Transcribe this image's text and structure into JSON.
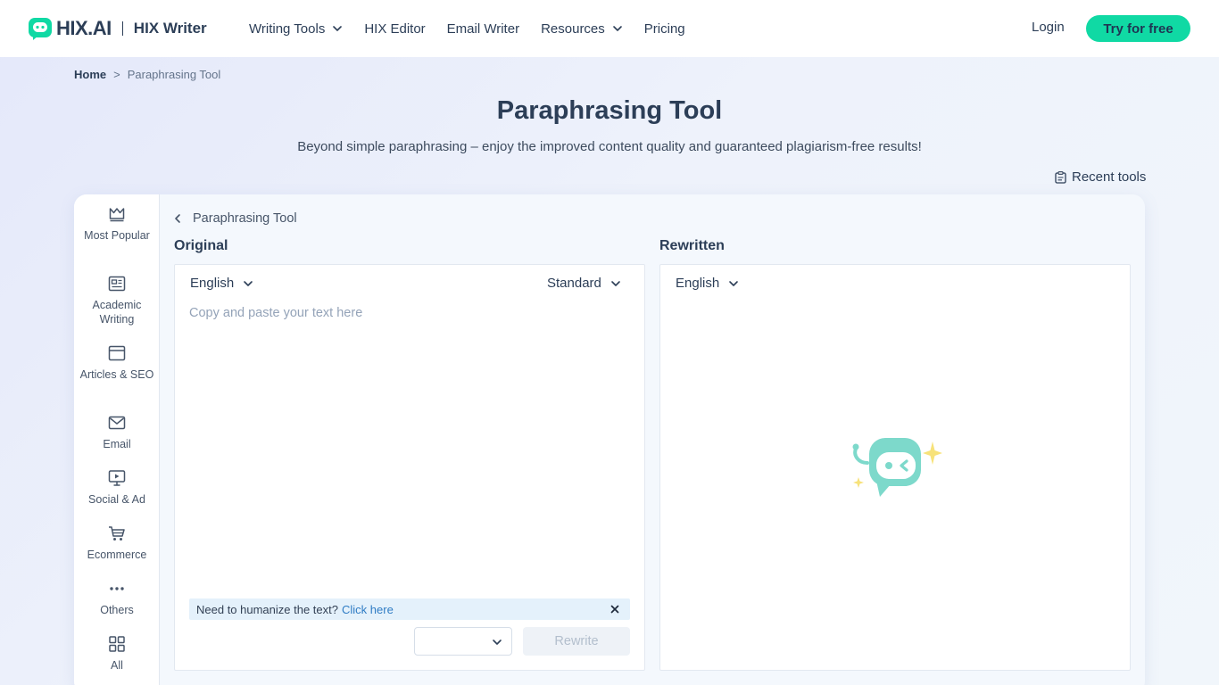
{
  "header": {
    "logo_text": "HIX.AI",
    "product": "HIX Writer",
    "nav": [
      {
        "label": "Writing Tools",
        "dropdown": true
      },
      {
        "label": "HIX Editor",
        "dropdown": false
      },
      {
        "label": "Email Writer",
        "dropdown": false
      },
      {
        "label": "Resources",
        "dropdown": true
      },
      {
        "label": "Pricing",
        "dropdown": false
      }
    ],
    "login": "Login",
    "cta": "Try for free"
  },
  "breadcrumb": {
    "home": "Home",
    "separator": ">",
    "current": "Paraphrasing Tool"
  },
  "page": {
    "title": "Paraphrasing Tool",
    "subtitle": "Beyond simple paraphrasing – enjoy the improved content quality and guaranteed plagiarism-free results!",
    "recent_tools": "Recent tools"
  },
  "sidebar": {
    "items": [
      {
        "icon": "crown-icon",
        "label": "Most Popular"
      },
      {
        "icon": "newspaper-icon",
        "label": "Academic Writing"
      },
      {
        "icon": "browser-window-icon",
        "label": "Articles & SEO"
      },
      {
        "icon": "mail-icon",
        "label": "Email"
      },
      {
        "icon": "presentation-icon",
        "label": "Social & Ad"
      },
      {
        "icon": "cart-icon",
        "label": "Ecommerce"
      },
      {
        "icon": "more-dots-icon",
        "label": "Others"
      },
      {
        "icon": "grid-icon",
        "label": "All"
      }
    ]
  },
  "tool": {
    "back_label": "Paraphrasing Tool",
    "original": {
      "heading": "Original",
      "language": "English",
      "mode": "Standard",
      "placeholder": "Copy and paste your text here",
      "value": "",
      "hint_text": "Need to humanize the text?",
      "hint_link": "Click here",
      "rewrite_label": "Rewrite"
    },
    "rewritten": {
      "heading": "Rewritten",
      "language": "English"
    }
  },
  "colors": {
    "accent": "#10d9a4",
    "text_dark": "#2c3e57",
    "link": "#2f7cc4",
    "mascot": "#7dd9cb",
    "sparkle": "#f7e27a"
  }
}
